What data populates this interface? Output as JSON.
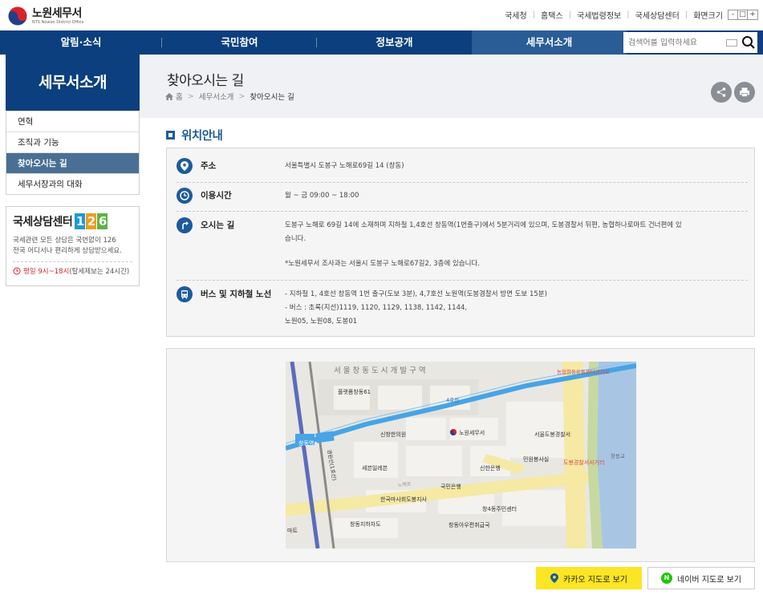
{
  "header": {
    "logo_title": "노원세무서",
    "logo_sub": "NTS Nowon District Office",
    "util_links": [
      "국세청",
      "홈택스",
      "국세법령정보",
      "국세상담센터"
    ],
    "zoom_label": "화면크기",
    "zoom_buttons": [
      "-",
      "□",
      "+"
    ]
  },
  "gnb": {
    "items": [
      "알림·소식",
      "국민참여",
      "정보공개",
      "세무서소개"
    ],
    "active_index": 3,
    "search_placeholder": "검색어를 입력하세요"
  },
  "sidebar": {
    "title": "세무서소개",
    "items": [
      "연혁",
      "조직과 기능",
      "찾아오시는 길",
      "세무서장과의 대화"
    ],
    "active_index": 2,
    "center": {
      "title": "국세상담센터",
      "digits": [
        "1",
        "2",
        "6"
      ],
      "digit_colors": [
        "#1a9ad6",
        "#f29b1f",
        "#5bb543"
      ],
      "desc_line1": "국세관련 모든 상담은 국번없이 126",
      "desc_line2": "전국 어디서나 편리하게 상담받으세요.",
      "hours_red": "평일 9시~18시",
      "hours_rest": " (탈세제보는 24시간)"
    }
  },
  "content": {
    "page_title": "찾아오시는 길",
    "breadcrumb": [
      "홈",
      "세무서소개",
      "찾아오시는 길"
    ],
    "section_title": "위치안내",
    "rows": [
      {
        "label": "주소",
        "icon": "location-pin-icon",
        "lines": [
          "서울특별시 도봉구 노해로69길 14 (창동)"
        ]
      },
      {
        "label": "이용시간",
        "icon": "clock-icon",
        "lines": [
          "월 ~ 금 09:00 ~ 18:00"
        ]
      },
      {
        "label": "오시는 길",
        "icon": "direction-icon",
        "lines": [
          "도봉구 노해로 69길 14에 소재하며 지하철 1,4호선 창동역(1번출구)에서 5분거리에 있으며, 도봉경찰서 뒤편, 농협하나로마트 건너편에 있",
          "습니다.",
          "",
          "*노원세무서 조사과는 서울시 도봉구 노해로67길2, 3층에 있습니다."
        ]
      },
      {
        "label": "버스 및 지하철 노선",
        "icon": "bus-icon",
        "lines": [
          "- 지하철 1, 4호선 창동역 1번 출구(도보 3분), 4,7호선 노원역(도봉경찰서 방면 도보 15분)",
          "- 버스 : 초록(지선)1119, 1120, 1129, 1138, 1142, 1144,",
          "노원05, 노원08, 도봉01"
        ]
      }
    ],
    "map_labels": {
      "district": "서 울 창 동 도 시 개 발 구 역",
      "plaza": "플랫폼창동61",
      "station": "창동역",
      "line4": "4호선",
      "line1_rail": "경원선(1호선)",
      "clinic": "신창한의원",
      "office": "노원세무서",
      "police": "서울도봉경찰서",
      "nonghyup": "농협창동유통센터교차로",
      "seyoung": "세븐일레븐",
      "shinhan": "신한은행",
      "minwon": "민원봉사실",
      "kookmin": "국민은행",
      "police_cross": "도봉경찰서사거리",
      "changdong_br": "창동교",
      "korea_horse": "한국마사회도봉지사",
      "community": "창4동주민센터",
      "post": "창동아우편취급국",
      "underpass": "창동지하차도",
      "mart": "마트",
      "route": "노해로"
    },
    "kakao_btn": "카카오 지도로 보기",
    "naver_btn": "네이버 지도로 보기"
  }
}
